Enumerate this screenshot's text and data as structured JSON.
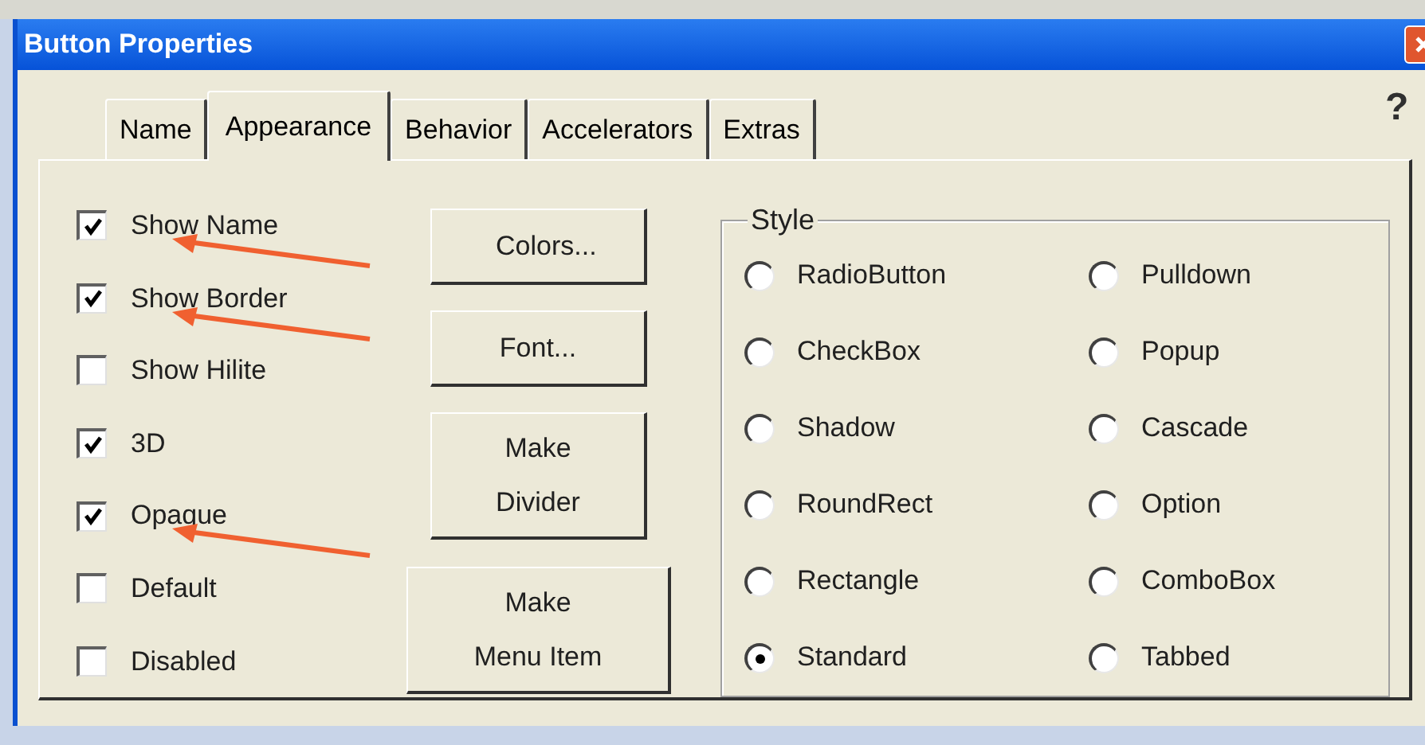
{
  "window": {
    "title": "Button Properties"
  },
  "help": "?",
  "tabs": [
    {
      "label": "Name",
      "selected": false
    },
    {
      "label": "Appearance",
      "selected": true
    },
    {
      "label": "Behavior",
      "selected": false
    },
    {
      "label": "Accelerators",
      "selected": false
    },
    {
      "label": "Extras",
      "selected": false
    }
  ],
  "options": [
    {
      "label": "Show Name",
      "checked": true,
      "annotated": true
    },
    {
      "label": "Show Border",
      "checked": true,
      "annotated": true
    },
    {
      "label": "Show Hilite",
      "checked": false,
      "annotated": false
    },
    {
      "label": "3D",
      "checked": true,
      "annotated": false
    },
    {
      "label": "Opaque",
      "checked": true,
      "annotated": true
    },
    {
      "label": "Default",
      "checked": false,
      "annotated": false
    },
    {
      "label": "Disabled",
      "checked": false,
      "annotated": false
    }
  ],
  "buttons": [
    {
      "label": "Colors...",
      "kind": "small"
    },
    {
      "label": "Font...",
      "kind": "small"
    },
    {
      "label": "Make Divider",
      "kind": "tall"
    },
    {
      "label": "Make Menu Item",
      "kind": "wide"
    }
  ],
  "style": {
    "title": "Style",
    "options": [
      {
        "label": "RadioButton",
        "selected": false
      },
      {
        "label": "Pulldown",
        "selected": false
      },
      {
        "label": "CheckBox",
        "selected": false
      },
      {
        "label": "Popup",
        "selected": false
      },
      {
        "label": "Shadow",
        "selected": false
      },
      {
        "label": "Cascade",
        "selected": false
      },
      {
        "label": "RoundRect",
        "selected": false
      },
      {
        "label": "Option",
        "selected": false
      },
      {
        "label": "Rectangle",
        "selected": false
      },
      {
        "label": "ComboBox",
        "selected": false
      },
      {
        "label": "Standard",
        "selected": true
      },
      {
        "label": "Tabbed",
        "selected": false
      }
    ]
  }
}
